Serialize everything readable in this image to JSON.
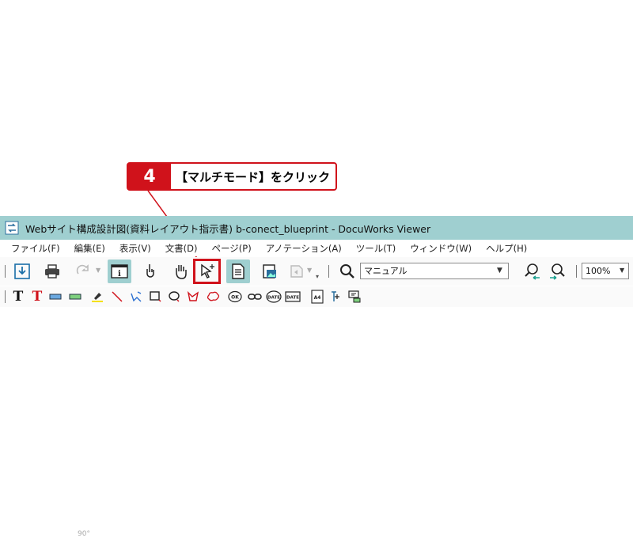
{
  "callout": {
    "step": "4",
    "text": "【マルチモード】をクリック",
    "color": "#d0121b"
  },
  "window": {
    "title": "Webサイト構成設計図(資料レイアウト指示書) b-conect_blueprint - DocuWorks Viewer",
    "title_bar_color": "#9fcfd0"
  },
  "menu": [
    "ファイル(F)",
    "編集(E)",
    "表示(V)",
    "文書(D)",
    "ページ(P)",
    "アノテーション(A)",
    "ツール(T)",
    "ウィンドウ(W)",
    "ヘルプ(H)"
  ],
  "toolbar": {
    "rotate_label": "90°",
    "search_value": "マニュアル",
    "zoom_value": "100%",
    "buttons": [
      {
        "icon": "download-icon"
      },
      {
        "icon": "print-icon"
      },
      {
        "icon": "rotate-icon",
        "disabled": true
      },
      {
        "icon": "info-view-icon",
        "active": true
      },
      {
        "icon": "finger-icon"
      },
      {
        "icon": "hand-icon"
      },
      {
        "icon": "multi-mode-icon",
        "highlighted": true
      },
      {
        "icon": "page-view-icon",
        "active": true
      },
      {
        "icon": "image-icon"
      },
      {
        "icon": "send-icon",
        "disabled": true
      },
      {
        "icon": "search-icon"
      },
      {
        "icon": "find-prev-icon"
      },
      {
        "icon": "find-next-icon"
      }
    ]
  },
  "annotation_toolbar": {
    "stamp_labels": [
      "OK",
      "DATE",
      "DATE",
      "A4"
    ]
  }
}
